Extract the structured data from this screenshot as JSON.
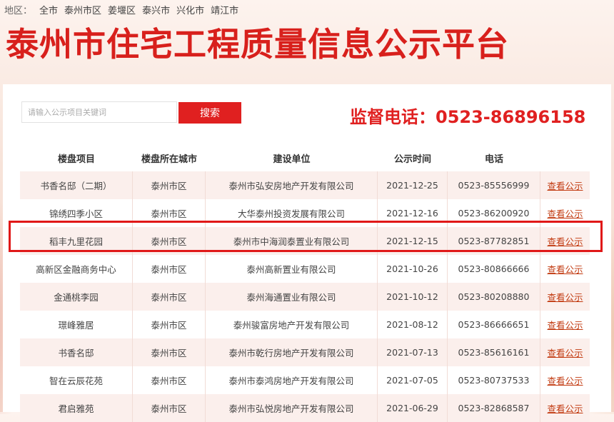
{
  "region_bar": {
    "label": "地区：",
    "items": [
      "全市",
      "泰州市区",
      "姜堰区",
      "泰兴市",
      "兴化市",
      "靖江市"
    ]
  },
  "site_title": "泰州市住宅工程质量信息公示平台",
  "search": {
    "placeholder": "请输入公示项目关键词",
    "button_label": "搜索"
  },
  "hotline": "监督电话：0523-86896158",
  "table": {
    "headers": [
      "楼盘项目",
      "楼盘所在城市",
      "建设单位",
      "公示时间",
      "电话",
      ""
    ],
    "link_label": "查看公示",
    "rows": [
      [
        "书香名邸（二期）",
        "泰州市区",
        "泰州市弘安房地产开发有限公司",
        "2021-12-25",
        "0523-85556999"
      ],
      [
        "锦绣四季小区",
        "泰州市区",
        "大华泰州投资发展有限公司",
        "2021-12-16",
        "0523-86200920"
      ],
      [
        "稻丰九里花园",
        "泰州市区",
        "泰州市中海润泰置业有限公司",
        "2021-12-15",
        "0523-87782851"
      ],
      [
        "高新区金融商务中心",
        "泰州市区",
        "泰州高新置业有限公司",
        "2021-10-26",
        "0523-80866666"
      ],
      [
        "金通桃李园",
        "泰州市区",
        "泰州海通置业有限公司",
        "2021-10-12",
        "0523-80208880"
      ],
      [
        "璟峰雅居",
        "泰州市区",
        "泰州骏富房地产开发有限公司",
        "2021-08-12",
        "0523-86666651"
      ],
      [
        "书香名邸",
        "泰州市区",
        "泰州市乾行房地产开发有限公司",
        "2021-07-13",
        "0523-85616161"
      ],
      [
        "智在云辰花苑",
        "泰州市区",
        "泰州市泰鸿房地产开发有限公司",
        "2021-07-05",
        "0523-80737533"
      ],
      [
        "君启雅苑",
        "泰州市区",
        "泰州市弘悦房地产开发有限公司",
        "2021-06-29",
        "0523-82868587"
      ]
    ]
  },
  "colors": {
    "brand_red": "#d8201c",
    "row_stripe": "#fbefec",
    "link": "#c23a10"
  }
}
